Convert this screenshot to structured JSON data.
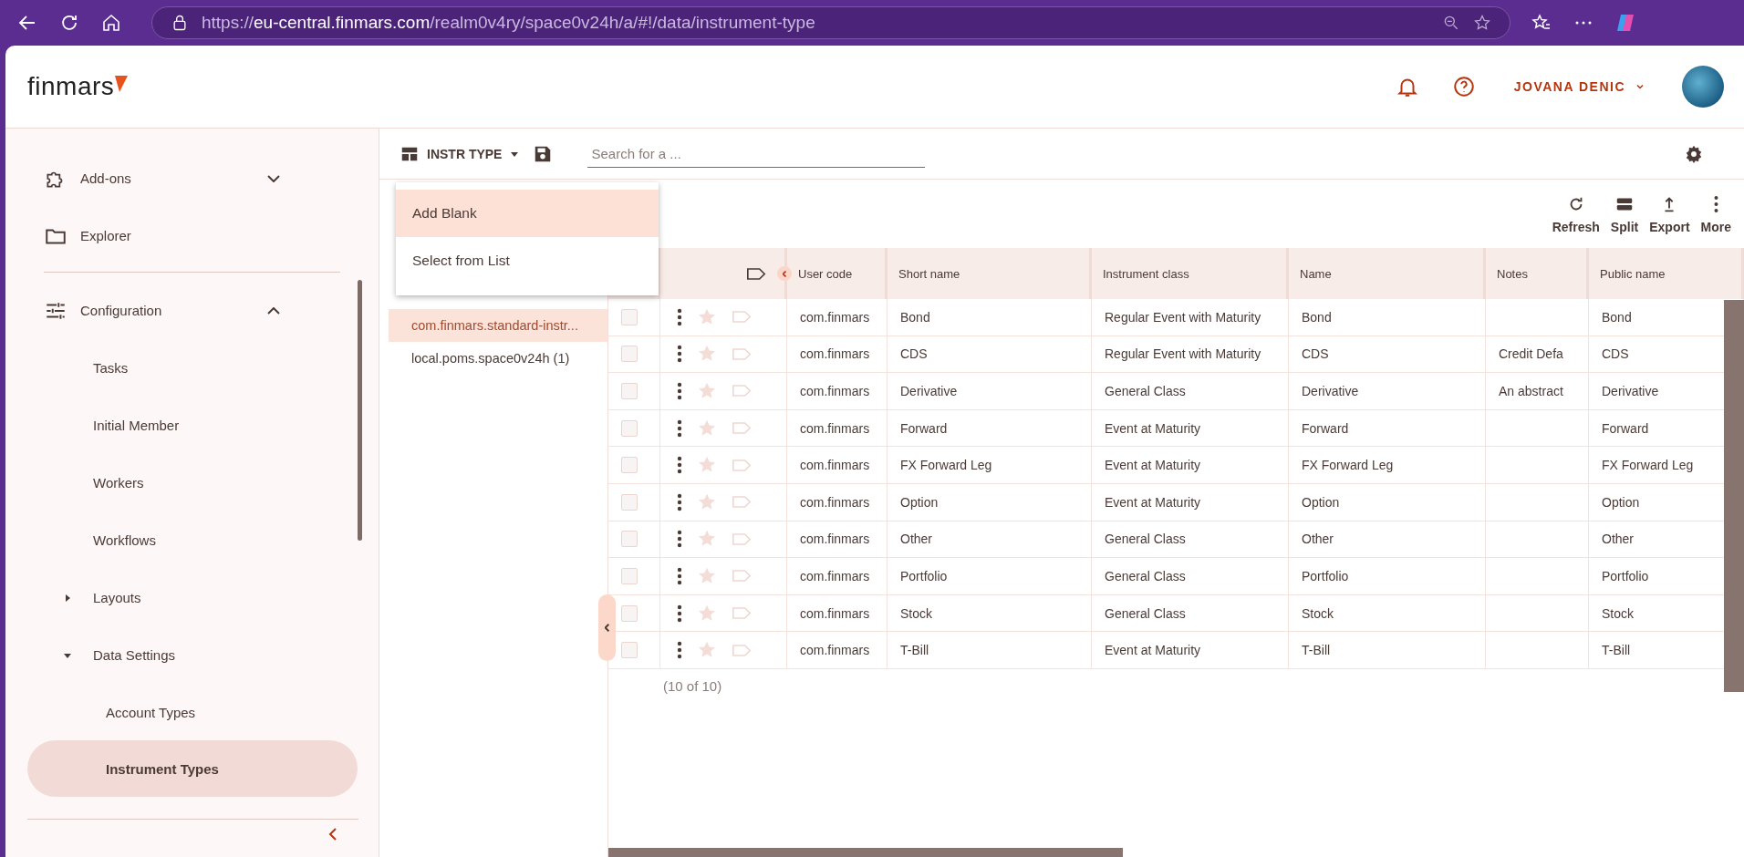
{
  "browser": {
    "url": {
      "scheme": "https://",
      "host": "eu-central.finmars.com",
      "path": "/realm0v4ry/space0v24h/a/#!/data/instrument-type"
    }
  },
  "header": {
    "logo": "finmars",
    "user": "JOVANA DENIC"
  },
  "sidebar": {
    "sections": [
      [
        {
          "label": "Add-ons",
          "selected": false,
          "expanded": false
        },
        {
          "label": "Explorer",
          "selected": false
        }
      ],
      [
        {
          "label": "Configuration",
          "selected": false,
          "expanded": true,
          "children": [
            {
              "label": "Tasks",
              "selected": false
            },
            {
              "label": "Initial Member",
              "selected": false
            },
            {
              "label": "Workers",
              "selected": false
            },
            {
              "label": "Workflows",
              "selected": false
            },
            {
              "label": "Layouts",
              "selected": false,
              "expanded": false
            },
            {
              "label": "Data Settings",
              "selected": false,
              "expanded": true,
              "children": [
                {
                  "label": "Account Types",
                  "selected": false
                },
                {
                  "label": "Instrument Types",
                  "selected": true
                }
              ]
            }
          ]
        }
      ]
    ]
  },
  "toolbar": {
    "layout_name": "INSTR TYPE",
    "search": {
      "placeholder": "Search for a ..."
    }
  },
  "add_menu": {
    "items": [
      {
        "label": "Add Blank",
        "selected": true
      },
      {
        "label": "Select from List",
        "selected": false
      }
    ]
  },
  "actions": [
    "Refresh",
    "Split",
    "Export",
    "More"
  ],
  "groups": [
    {
      "label": "com.finmars.standard-instr...",
      "selected": true
    },
    {
      "label": "local.poms.space0v24h (1)",
      "selected": false
    }
  ],
  "table": {
    "columns": [
      "User code",
      "Short name",
      "Instrument class",
      "Name",
      "Notes",
      "Public name"
    ],
    "rows": [
      {
        "checked": false,
        "favorite": false,
        "user_code": "com.finmars",
        "short_name": "Bond",
        "instrument_class": "Regular Event with Maturity",
        "name": "Bond",
        "public_name": "Bond"
      },
      {
        "checked": false,
        "favorite": false,
        "user_code": "com.finmars",
        "short_name": "CDS",
        "instrument_class": "Regular Event with Maturity",
        "name": "CDS",
        "notes": "Credit Defa",
        "public_name": "CDS"
      },
      {
        "checked": false,
        "favorite": false,
        "user_code": "com.finmars",
        "short_name": "Derivative",
        "instrument_class": "General Class",
        "name": "Derivative",
        "notes": "An abstract",
        "public_name": "Derivative"
      },
      {
        "checked": false,
        "favorite": false,
        "user_code": "com.finmars",
        "short_name": "Forward",
        "instrument_class": "Event at Maturity",
        "name": "Forward",
        "public_name": "Forward"
      },
      {
        "checked": false,
        "favorite": false,
        "user_code": "com.finmars",
        "short_name": "FX Forward Leg",
        "instrument_class": "Event at Maturity",
        "name": "FX Forward Leg",
        "public_name": "FX Forward Leg"
      },
      {
        "checked": false,
        "favorite": false,
        "user_code": "com.finmars",
        "short_name": "Option",
        "instrument_class": "Event at Maturity",
        "name": "Option",
        "public_name": "Option"
      },
      {
        "checked": false,
        "favorite": false,
        "user_code": "com.finmars",
        "short_name": "Other",
        "instrument_class": "General Class",
        "name": "Other",
        "public_name": "Other"
      },
      {
        "checked": false,
        "favorite": false,
        "user_code": "com.finmars",
        "short_name": "Portfolio",
        "instrument_class": "General Class",
        "name": "Portfolio",
        "public_name": "Portfolio"
      },
      {
        "checked": false,
        "favorite": false,
        "user_code": "com.finmars",
        "short_name": "Stock",
        "instrument_class": "General Class",
        "name": "Stock",
        "public_name": "Stock"
      },
      {
        "checked": false,
        "favorite": false,
        "user_code": "com.finmars",
        "short_name": "T-Bill",
        "instrument_class": "Event at Maturity",
        "name": "T-Bill",
        "public_name": "T-Bill"
      }
    ],
    "footer": "(10 of 10)"
  }
}
